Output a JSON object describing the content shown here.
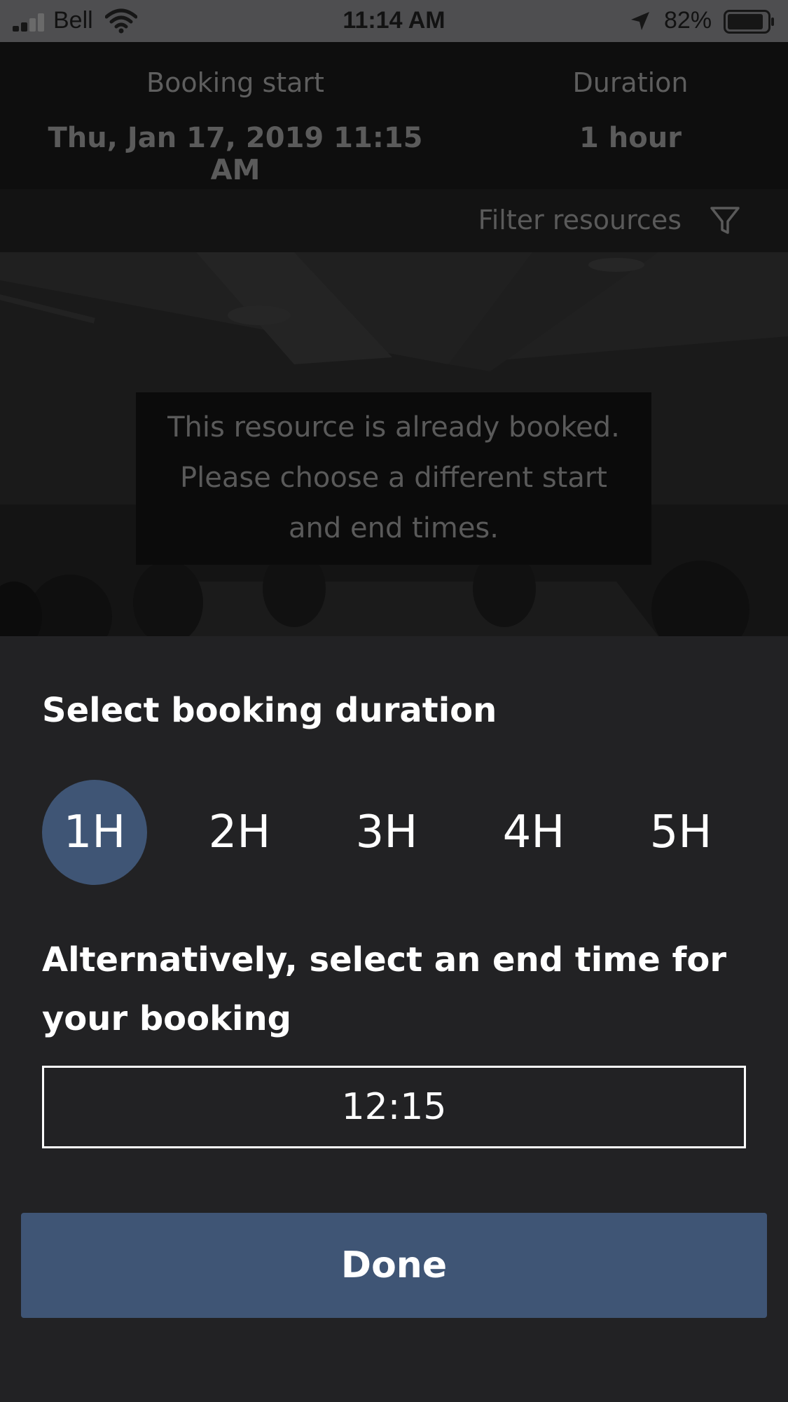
{
  "status_bar": {
    "carrier": "Bell",
    "time": "11:14 AM",
    "battery_percent": "82%",
    "battery_level": 0.82,
    "icons": [
      "signal-icon",
      "wifi-icon",
      "location-arrow-icon",
      "battery-icon"
    ]
  },
  "header": {
    "start_label": "Booking start",
    "start_value": "Thu, Jan 17, 2019 11:15 AM",
    "duration_label": "Duration",
    "duration_value": "1 hour"
  },
  "filter": {
    "label": "Filter resources",
    "icon": "funnel-icon"
  },
  "notice": {
    "line1": "This resource is already booked.",
    "line2": "Please choose a different start",
    "line3": "and end times."
  },
  "sheet": {
    "title": "Select booking duration",
    "durations": [
      {
        "label": "1H",
        "selected": true
      },
      {
        "label": "2H",
        "selected": false
      },
      {
        "label": "3H",
        "selected": false
      },
      {
        "label": "4H",
        "selected": false
      },
      {
        "label": "5H",
        "selected": false
      }
    ],
    "alt_line1": "Alternatively, select an end time for",
    "alt_line2": "your booking",
    "end_time": "12:15",
    "done_label": "Done"
  },
  "colors": {
    "accent": "#3f5575",
    "sheet_background": "#222224"
  }
}
